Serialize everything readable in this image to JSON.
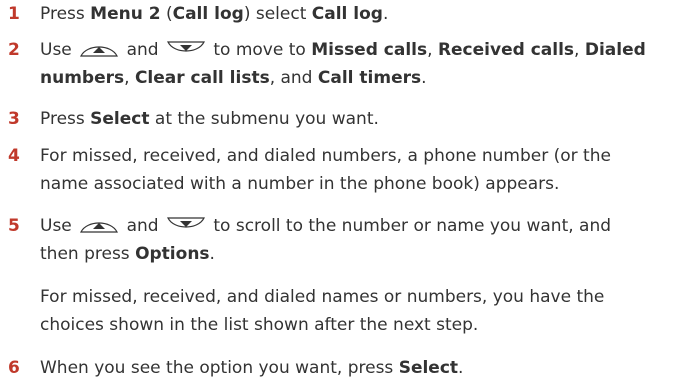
{
  "steps": [
    {
      "num": "1",
      "parts": [
        "Press ",
        "Menu 2",
        " (",
        "Call log",
        ") select ",
        "Call log",
        "."
      ]
    },
    {
      "num": "2",
      "line1": [
        "Use ",
        " and ",
        " to move to ",
        "Missed calls",
        ", ",
        "Received calls",
        ", ",
        "Dialed"
      ],
      "line2": [
        "numbers",
        ", ",
        "Clear call lists",
        ", and ",
        "Call timers",
        "."
      ]
    },
    {
      "num": "3",
      "parts": [
        "Press ",
        "Select",
        " at the submenu you want."
      ]
    },
    {
      "num": "4",
      "line1": "For missed, received, and dialed numbers, a phone number (or the",
      "line2": "name associated with a number in the phone book) appears."
    },
    {
      "num": "5",
      "line1": [
        "Use ",
        " and ",
        " to scroll to the number or name you want, and"
      ],
      "line2": [
        "then press ",
        "Options",
        "."
      ]
    },
    {
      "num": "6",
      "parts": [
        "When you see the option you want, press ",
        "Select",
        "."
      ]
    }
  ],
  "note": {
    "line1": "For missed, received, and dialed names or numbers, you have the",
    "line2": "choices shown in the list shown after the next step."
  },
  "icons": {
    "up": "scroll-up-key-icon",
    "down": "scroll-down-key-icon"
  },
  "colors": {
    "step_number": "#c0392b",
    "text": "#333333"
  }
}
